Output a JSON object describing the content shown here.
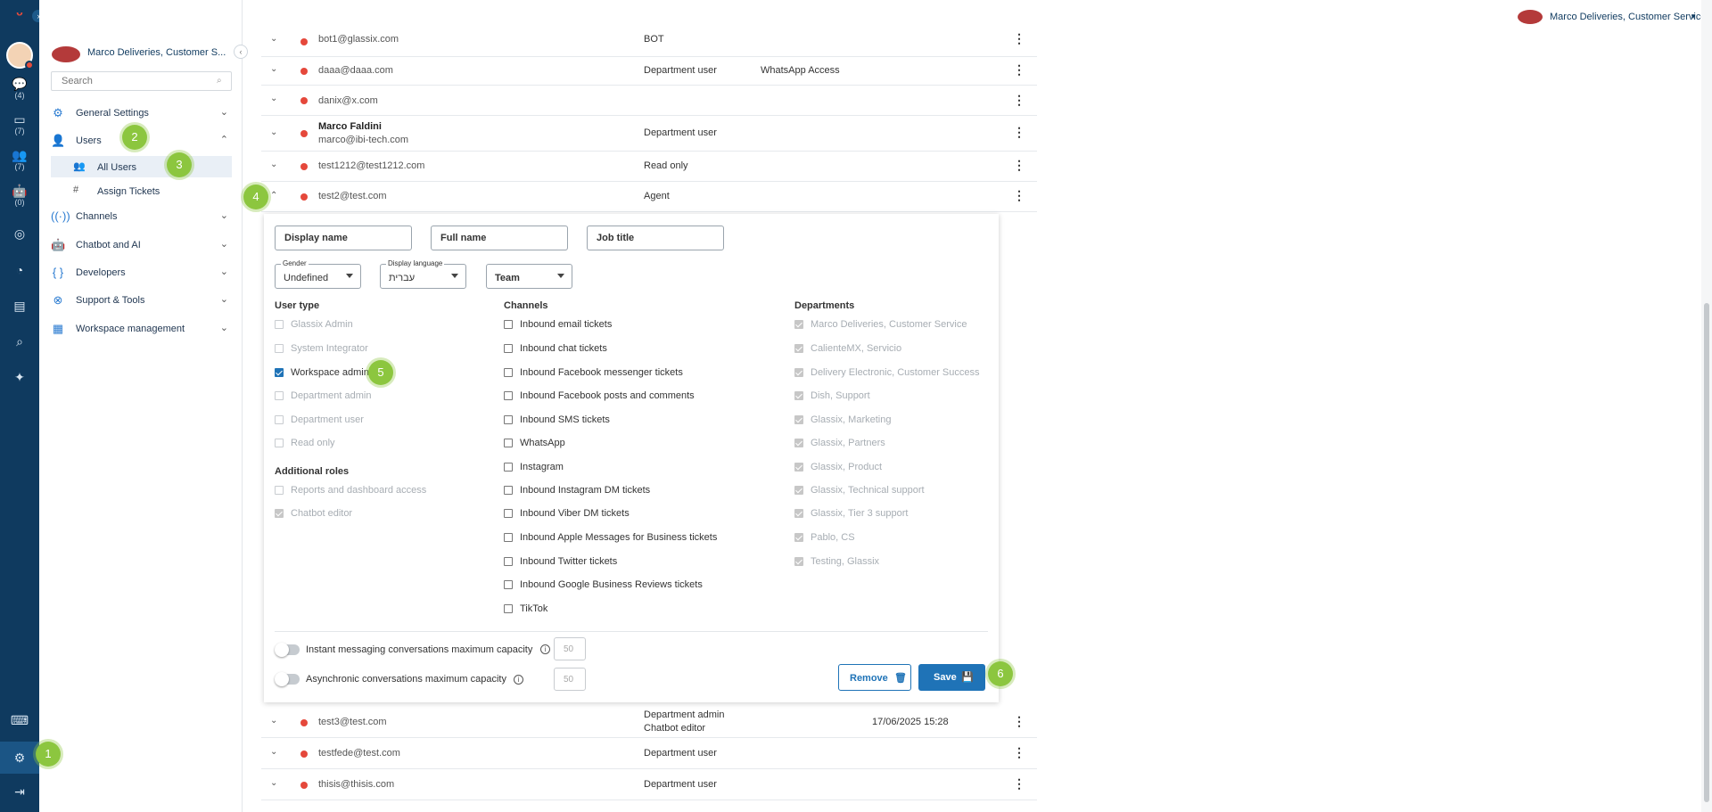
{
  "topbar": {
    "workspace": "Marco Deliveries, Customer Service",
    "dropdown_icon": "caret-down-icon"
  },
  "rail": {
    "counts": {
      "chats": "(4)",
      "inbox": "(7)",
      "contacts": "(7)",
      "bots": "(0)"
    }
  },
  "sidebar": {
    "workspace": "Marco Deliveries, Customer S...",
    "search_placeholder": "Search",
    "items": {
      "general": "General Settings",
      "users": "Users",
      "all_users": "All Users",
      "assign_tickets": "Assign Tickets",
      "channels": "Channels",
      "chatbot": "Chatbot and AI",
      "developers": "Developers",
      "support": "Support & Tools",
      "workspace": "Workspace management"
    }
  },
  "badges": [
    "1",
    "2",
    "3",
    "4",
    "5",
    "6"
  ],
  "users_table": {
    "rows": [
      {
        "email": "bot1@glassix.com",
        "role": "BOT",
        "extra": ""
      },
      {
        "email": "daaa@daaa.com",
        "role": "Department user",
        "extra": "WhatsApp Access"
      },
      {
        "email": "danix@x.com",
        "role": "",
        "extra": ""
      },
      {
        "name": "Marco Faldini",
        "email": "marco@ibi-tech.com",
        "role": "Department user",
        "extra": ""
      },
      {
        "email": "test1212@test1212.com",
        "role": "Read only",
        "extra": ""
      },
      {
        "email": "test2@test.com",
        "role": "Agent",
        "extra": ""
      }
    ],
    "rows_after": [
      {
        "email": "test3@test.com",
        "role": "Department admin",
        "role2": "Chatbot editor",
        "date": "17/06/2025 15:28"
      },
      {
        "email": "testfede@test.com",
        "role": "Department user"
      },
      {
        "email": "thisis@thisis.com",
        "role": "Department user"
      }
    ]
  },
  "editor": {
    "fields": {
      "display_name": "Display name",
      "full_name": "Full name",
      "job_title": "Job title"
    },
    "selects": {
      "gender_caption": "Gender",
      "gender_value": "Undefined",
      "language_caption": "Display language",
      "language_value": "עברית",
      "team_value": "Team"
    },
    "user_type": {
      "header": "User type",
      "options": [
        {
          "label": "Glassix Admin",
          "checked": false,
          "disabled": true
        },
        {
          "label": "System Integrator",
          "checked": false,
          "disabled": true
        },
        {
          "label": "Workspace admin",
          "checked": true,
          "disabled": false
        },
        {
          "label": "Department admin",
          "checked": false,
          "disabled": true
        },
        {
          "label": "Department user",
          "checked": false,
          "disabled": true
        },
        {
          "label": "Read only",
          "checked": false,
          "disabled": true
        }
      ]
    },
    "additional_roles": {
      "header": "Additional roles",
      "options": [
        {
          "label": "Reports and dashboard access",
          "checked": false
        },
        {
          "label": "Chatbot editor",
          "checked": true
        }
      ]
    },
    "channels": {
      "header": "Channels",
      "options": [
        "Inbound email tickets",
        "Inbound chat tickets",
        "Inbound Facebook messenger tickets",
        "Inbound Facebook posts and comments",
        "Inbound SMS tickets",
        "WhatsApp",
        "Instagram",
        "Inbound Instagram DM tickets",
        "Inbound Viber DM tickets",
        "Inbound Apple Messages for Business tickets",
        "Inbound Twitter tickets",
        "Inbound Google Business Reviews tickets",
        "TikTok"
      ]
    },
    "departments": {
      "header": "Departments",
      "options": [
        "Marco Deliveries, Customer Service",
        "CalienteMX, Servicio",
        "Delivery Electronic, Customer Success",
        "Dish, Support",
        "Glassix, Marketing",
        "Glassix, Partners",
        "Glassix, Product",
        "Glassix, Technical support",
        "Glassix, Tier 3 support",
        "Pablo, CS",
        "Testing, Glassix"
      ]
    },
    "capacity": {
      "im_label": "Instant messaging conversations maximum capacity",
      "im_value": "50",
      "async_label": "Asynchronic conversations maximum capacity",
      "async_value": "50"
    },
    "buttons": {
      "remove": "Remove",
      "save": "Save"
    }
  }
}
